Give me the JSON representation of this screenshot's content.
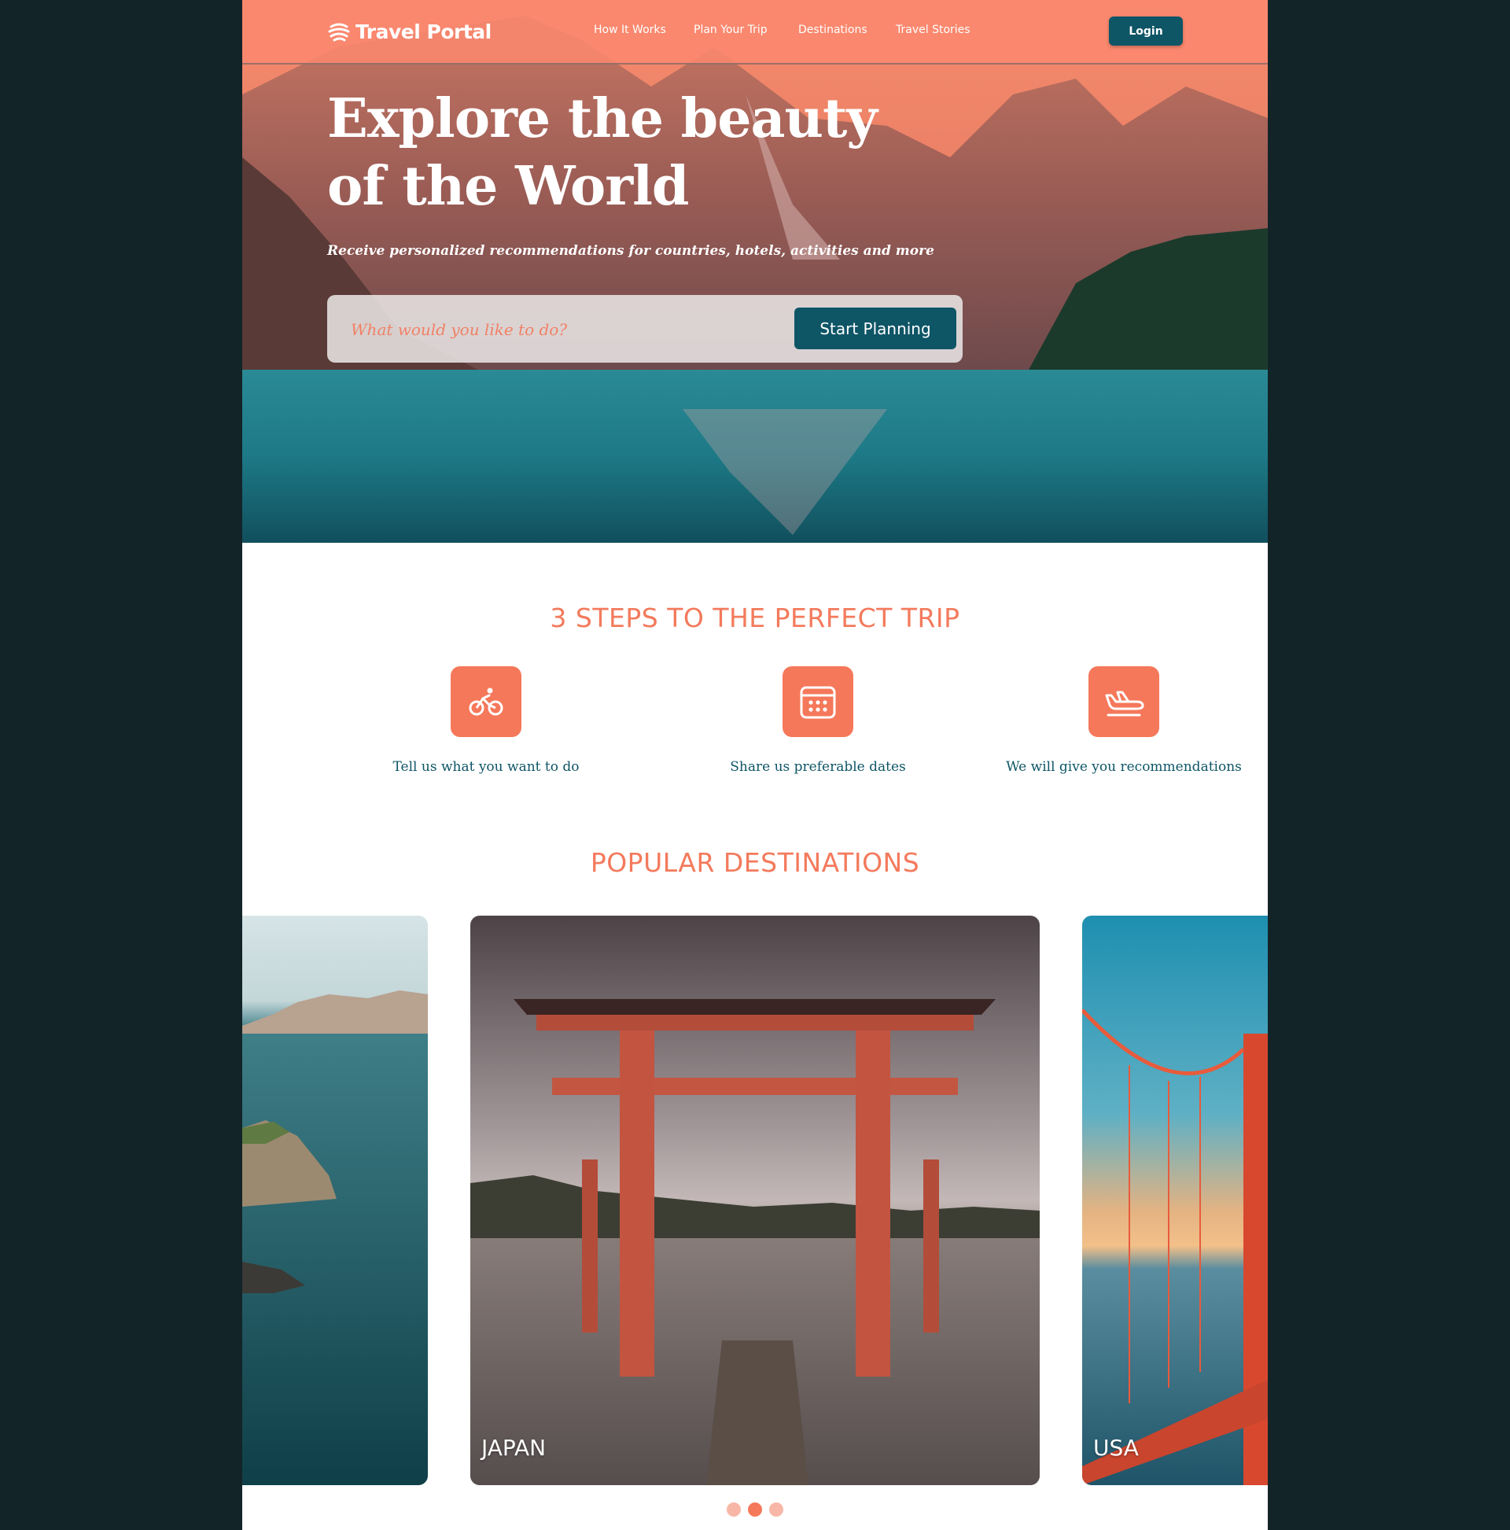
{
  "brand": {
    "name": "Travel Portal",
    "logo_icon": "swirl-logo-icon"
  },
  "nav": {
    "links": [
      "How It Works",
      "Plan Your Trip",
      "Destinations",
      "Travel Stories"
    ],
    "login_label": "Login"
  },
  "hero": {
    "title": "Explore the beauty of the World",
    "subtitle": "Receive personalized recommendations for countries, hotels, activities and more",
    "search_placeholder": "What would you like to do?",
    "cta_label": "Start Planning"
  },
  "steps": {
    "title": "3 STEPS TO THE PERFECT TRIP",
    "items": [
      {
        "label": "Tell us what you want to do",
        "icon": "bicycle-icon"
      },
      {
        "label": "Share us preferable dates",
        "icon": "calendar-icon"
      },
      {
        "label": "We will give you recommendations",
        "icon": "airplane-icon"
      }
    ]
  },
  "destinations": {
    "title": "POPULAR DESTINATIONS",
    "cards": [
      {
        "label": ""
      },
      {
        "label": "JAPAN"
      },
      {
        "label": "USA"
      }
    ],
    "dots_count": 3,
    "active_dot": 2
  },
  "colors": {
    "accent": "#f5785a",
    "primary": "#0e5566",
    "background": "#132429"
  }
}
